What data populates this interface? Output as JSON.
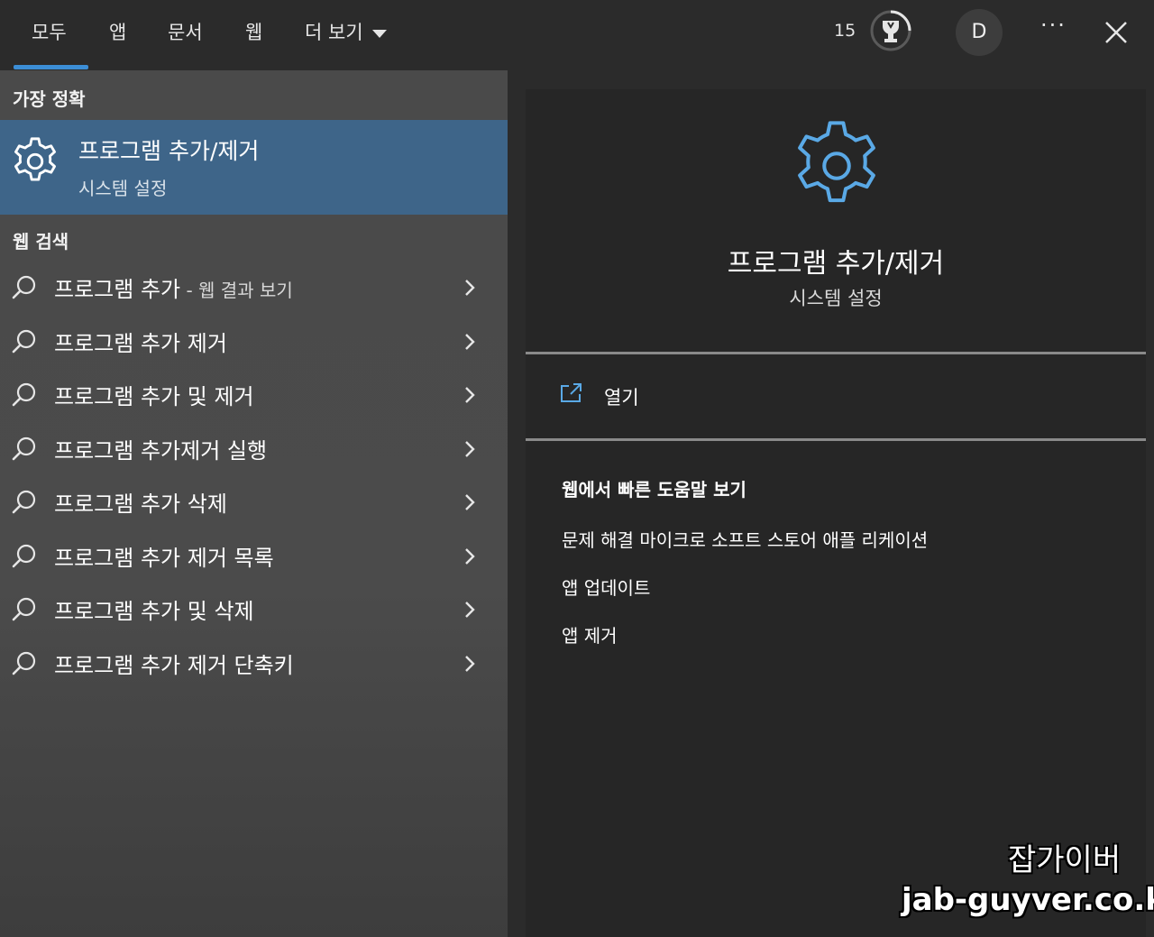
{
  "tabs": [
    {
      "label": "모두"
    },
    {
      "label": "앱"
    },
    {
      "label": "문서"
    },
    {
      "label": "웹"
    },
    {
      "label": "더 보기"
    }
  ],
  "header": {
    "points": "15",
    "avatar_initial": "D",
    "more_options": "···"
  },
  "best_match": {
    "section_title": "가장 정확",
    "title": "프로그램 추가/제거",
    "subtitle": "시스템 설정"
  },
  "web_search": {
    "section_title": "웹 검색",
    "items": [
      {
        "label": "프로그램 추가",
        "suffix": " - 웹 결과 보기"
      },
      {
        "label": "프로그램 추가 제거",
        "suffix": ""
      },
      {
        "label": "프로그램 추가 및 제거",
        "suffix": ""
      },
      {
        "label": "프로그램 추가제거 실행",
        "suffix": ""
      },
      {
        "label": "프로그램 추가 삭제",
        "suffix": ""
      },
      {
        "label": "프로그램 추가 제거 목록",
        "suffix": ""
      },
      {
        "label": "프로그램 추가 및 삭제",
        "suffix": ""
      },
      {
        "label": "프로그램 추가 제거 단축키",
        "suffix": ""
      }
    ]
  },
  "preview": {
    "title": "프로그램 추가/제거",
    "subtitle": "시스템 설정",
    "open_label": "열기",
    "help_title": "웹에서 빠른 도움말 보기",
    "help_links": [
      "문제 해결 마이크로 소프트 스토어 애플 리케이션",
      "앱 업데이트",
      "앱 제거"
    ]
  },
  "watermark": {
    "line1": "잡가이버",
    "line2": "jab-guyver.co.kr"
  },
  "colors": {
    "accent": "#3c8ed6",
    "selected_bg": "#3e6589",
    "gear_blue": "#5aa9e6"
  }
}
